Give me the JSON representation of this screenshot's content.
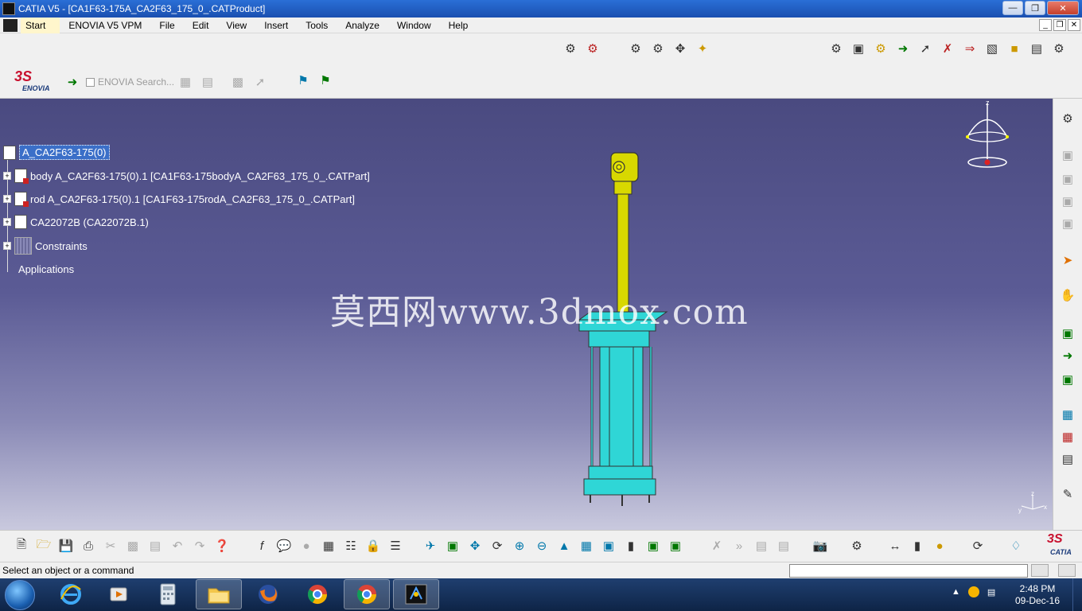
{
  "window": {
    "title": "CATIA V5 - [CA1F63-175A_CA2F63_175_0_.CATProduct]"
  },
  "menu": [
    "Start",
    "ENOVIA V5 VPM",
    "File",
    "Edit",
    "View",
    "Insert",
    "Tools",
    "Analyze",
    "Window",
    "Help"
  ],
  "enovia": {
    "logo_text": "ENOVIA",
    "search_label": "ENOVIA Search..."
  },
  "tree": {
    "root": "A_CA2F63-175(0)",
    "children": [
      "body A_CA2F63-175(0).1 [CA1F63-175bodyA_CA2F63_175_0_.CATPart]",
      "rod A_CA2F63-175(0).1 [CA1F63-175rodA_CA2F63_175_0_.CATPart]",
      "CA22072B (CA22072B.1)",
      "Constraints"
    ],
    "applications": "Applications"
  },
  "watermark": "莫西网www.3dmox.com",
  "compass": {
    "z_label": "z"
  },
  "mini_axis": {
    "x": "x",
    "y": "y",
    "z": "z"
  },
  "status": {
    "message": "Select an object or a command"
  },
  "catia_logo_text": "CATIA",
  "clock": {
    "time": "2:48 PM",
    "date": "09-Dec-16"
  },
  "colors": {
    "cylinder": "#2fd6d6",
    "rod": "#d8d800",
    "viewport_top": "#4a4a80",
    "viewport_bottom": "#c9c9de",
    "tree_highlight": "#3b6fc8"
  }
}
